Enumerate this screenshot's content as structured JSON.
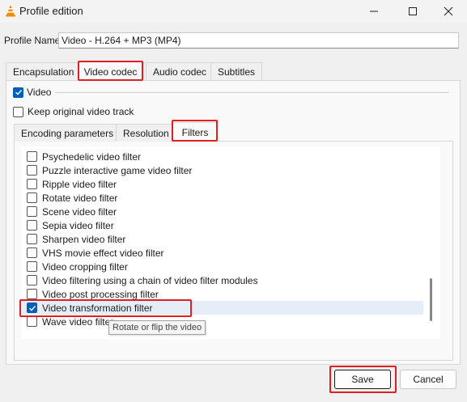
{
  "window": {
    "title": "Profile edition",
    "app_icon": "vlc-cone-icon",
    "controls": [
      "minimize-icon",
      "maximize-icon",
      "close-icon"
    ]
  },
  "profile": {
    "name_label": "Profile Name",
    "name_value": "Video - H.264 + MP3 (MP4)"
  },
  "tabs": [
    {
      "label": "Encapsulation",
      "active": false
    },
    {
      "label": "Video codec",
      "active": true
    },
    {
      "label": "Audio codec",
      "active": false
    },
    {
      "label": "Subtitles",
      "active": false
    }
  ],
  "video": {
    "video_label": "Video",
    "video_checked": true,
    "keep_original_label": "Keep original video track",
    "keep_original_checked": false
  },
  "subtabs": [
    {
      "label": "Encoding parameters",
      "active": false
    },
    {
      "label": "Resolution",
      "active": false
    },
    {
      "label": "Filters",
      "active": true
    }
  ],
  "filters": [
    {
      "label": "Psychedelic video filter",
      "checked": false
    },
    {
      "label": "Puzzle interactive game video filter",
      "checked": false
    },
    {
      "label": "Ripple video filter",
      "checked": false
    },
    {
      "label": "Rotate video filter",
      "checked": false
    },
    {
      "label": "Scene video filter",
      "checked": false
    },
    {
      "label": "Sepia video filter",
      "checked": false
    },
    {
      "label": "Sharpen video filter",
      "checked": false
    },
    {
      "label": "VHS movie effect video filter",
      "checked": false
    },
    {
      "label": "Video cropping filter",
      "checked": false
    },
    {
      "label": "Video filtering using a chain of video filter modules",
      "checked": false
    },
    {
      "label": "Video post processing filter",
      "checked": false
    },
    {
      "label": "Video transformation filter",
      "checked": true
    },
    {
      "label": "Wave video filter",
      "checked": false
    }
  ],
  "tooltip": "Rotate or flip the video",
  "buttons": {
    "save": "Save",
    "cancel": "Cancel"
  },
  "highlight_color": "#e02020",
  "accent_color": "#005fb8"
}
